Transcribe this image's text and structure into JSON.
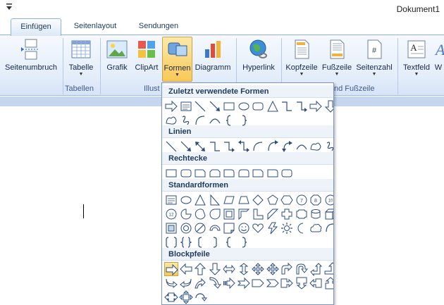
{
  "window": {
    "document_title": "Dokument1",
    "qat_icon": "customize-quick-access-icon"
  },
  "tabs": [
    {
      "label": "Einfügen",
      "active": true
    },
    {
      "label": "Seitenlayout",
      "active": false
    },
    {
      "label": "Sendungen",
      "active": false
    }
  ],
  "ribbon": {
    "buttons": [
      {
        "label": "Seitenumbruch",
        "icon": "page-break-icon",
        "dropdown": false
      },
      {
        "label": "Tabelle",
        "icon": "table-icon",
        "dropdown": true
      },
      {
        "label": "Grafik",
        "icon": "picture-icon",
        "dropdown": false
      },
      {
        "label": "ClipArt",
        "icon": "clipart-icon",
        "dropdown": false
      },
      {
        "label": "Formen",
        "icon": "shapes-icon",
        "dropdown": true,
        "active": true
      },
      {
        "label": "Diagramm",
        "icon": "chart-icon",
        "dropdown": false
      },
      {
        "label": "Hyperlink",
        "icon": "hyperlink-globe-icon",
        "dropdown": false
      },
      {
        "label": "Kopfzeile",
        "icon": "header-icon",
        "dropdown": true
      },
      {
        "label": "Fußzeile",
        "icon": "footer-icon",
        "dropdown": true
      },
      {
        "label": "Seitenzahl",
        "icon": "page-number-icon",
        "dropdown": true
      },
      {
        "label": "Textfeld",
        "icon": "textbox-icon",
        "dropdown": true
      },
      {
        "label": "W",
        "icon": "wordart-icon",
        "dropdown": false
      }
    ],
    "groups": {
      "tables": "Tabellen",
      "illustrations": "Illust",
      "header_footer": "nd Fußzeile"
    }
  },
  "shapes_menu": {
    "sections": [
      {
        "title": "Zuletzt verwendete Formen",
        "rows": 2
      },
      {
        "title": "Linien",
        "rows": 1
      },
      {
        "title": "Rechtecke",
        "rows": 1
      },
      {
        "title": "Standardformen",
        "rows": 4
      },
      {
        "title": "Blockpfeile",
        "rows": 3
      }
    ]
  },
  "colors": {
    "accent": "#f8c857",
    "ribbon_border": "#8db2e3",
    "text": "#1e395b"
  }
}
